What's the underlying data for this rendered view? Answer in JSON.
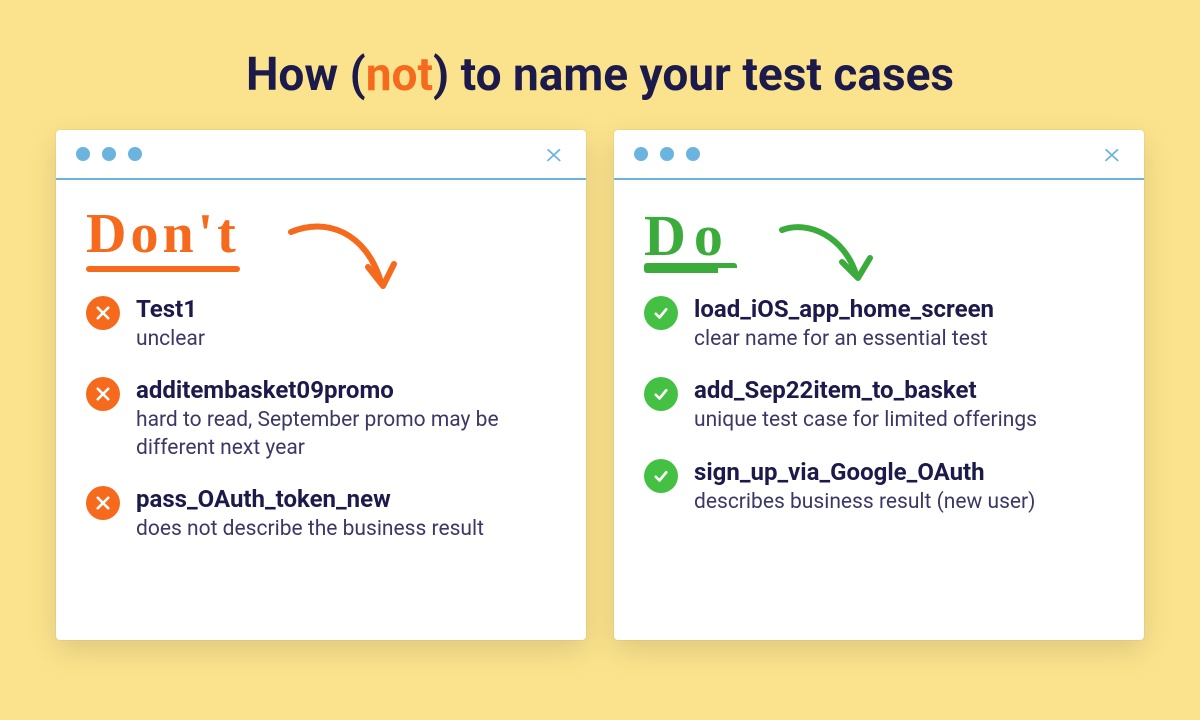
{
  "title": {
    "prefix": "How (",
    "accent": "not",
    "suffix": ") to name your test cases"
  },
  "panels": {
    "dont": {
      "heading": "Don't",
      "items": [
        {
          "title": "Test1",
          "desc": "unclear"
        },
        {
          "title": "additembasket09promo",
          "desc": "hard to read, September promo may be different next year"
        },
        {
          "title": "pass_OAuth_token_new",
          "desc": "does not describe the business result"
        }
      ]
    },
    "do": {
      "heading": "Do",
      "items": [
        {
          "title": "load_iOS_app_home_screen",
          "desc": "clear name for an essential test"
        },
        {
          "title": "add_Sep22item_to_basket",
          "desc": "unique test case for limited offerings"
        },
        {
          "title": "sign_up_via_Google_OAuth",
          "desc": "describes business result (new user)"
        }
      ]
    }
  }
}
